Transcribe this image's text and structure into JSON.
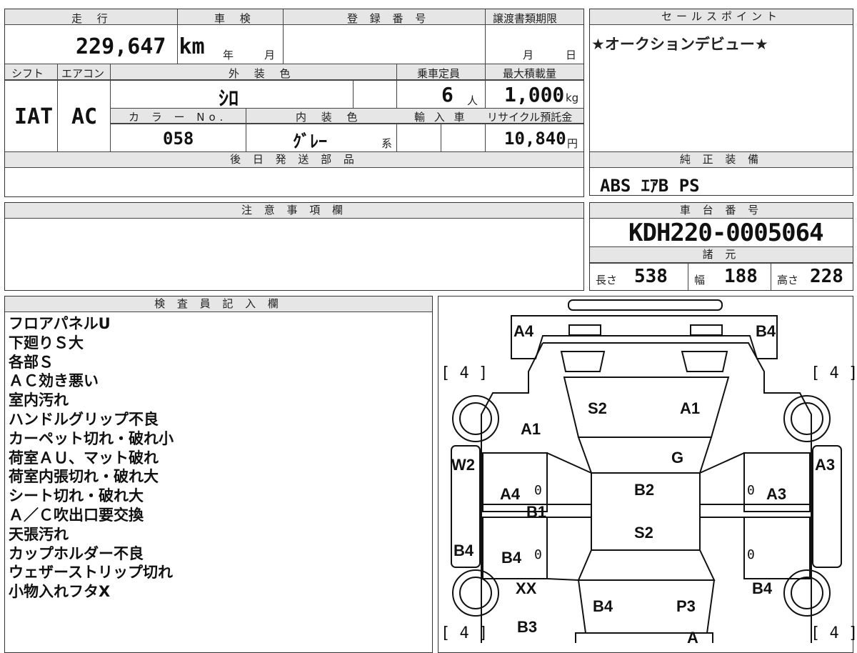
{
  "header": {
    "mileage_label": "走 行",
    "inspection_label": "車 検",
    "registration_label": "登 録 番 号",
    "transfer_deadline_label": "譲渡書類期限",
    "sales_point_label": "セールスポイント"
  },
  "mileage": "229,647 km",
  "inspection": {
    "year_unit": "年",
    "month_unit": "月"
  },
  "transfer_deadline": {
    "month_unit": "月",
    "day_unit": "日"
  },
  "sales_point": "★オークションデビュー★",
  "row2_labels": {
    "shift": "シフト",
    "aircon": "エアコン",
    "exterior_color": "外 装 色",
    "capacity": "乗車定員",
    "max_load": "最大積載量"
  },
  "shift": "IAT",
  "aircon": "AC",
  "exterior_color": "ｼﾛ",
  "capacity": {
    "value": "6",
    "unit": "人"
  },
  "max_load": {
    "value": "1,000",
    "unit": "kg"
  },
  "row3_labels": {
    "color_no": "カ ラ ー No.",
    "interior_color": "内 装 色",
    "imported": "輸 入 車",
    "recycle_fee": "リサイクル預託金"
  },
  "color_no": "058",
  "interior_color": {
    "value": "ｸﾞﾚｰ",
    "suffix": "系"
  },
  "recycle_fee": {
    "value": "10,840",
    "unit": "円"
  },
  "later_parts_label": "後 日 発 送 部 品",
  "standard_equipment": {
    "label": "純 正 装 備",
    "value": "ABS ｴｱB PS"
  },
  "caution_label": "注 意 事 項 欄",
  "chassis": {
    "label": "車 台 番 号",
    "value": "KDH220-0005064"
  },
  "specs": {
    "label": "諸 元",
    "length_label": "長さ",
    "length": "538",
    "width_label": "幅",
    "width": "188",
    "height_label": "高さ",
    "height": "228"
  },
  "inspector_label": "検 査 員 記 入 欄",
  "inspector_notes": [
    "フロアパネルU",
    "下廻りＳ大",
    "各部Ｓ",
    "ＡＣ効き悪い",
    "室内汚れ",
    "ハンドルグリップ不良",
    "カーペット切れ・破れ小",
    "荷室ＡＵ、マット破れ",
    "荷室内張切れ・破れ大",
    "シート切れ・破れ大",
    "Ａ／Ｃ吹出口要交換",
    "天張汚れ",
    "カップホルダー不良",
    "ウェザーストリップ切れ",
    "小物入れフタX"
  ],
  "diagram": {
    "tire_marks": [
      "[ 4 ]",
      "[ 4 ]",
      "[ 4 ]",
      "[ 4 ]"
    ],
    "labels": [
      "A4",
      "B4",
      "S2",
      "A1",
      "A1",
      "G",
      "W2",
      "A3",
      "A4",
      "B2",
      "A3",
      "B1",
      "S2",
      "B4",
      "B4",
      "XX",
      "B4",
      "B4",
      "P3",
      "B3",
      "A"
    ],
    "zeros": [
      "0",
      "0",
      "0",
      "0"
    ]
  }
}
